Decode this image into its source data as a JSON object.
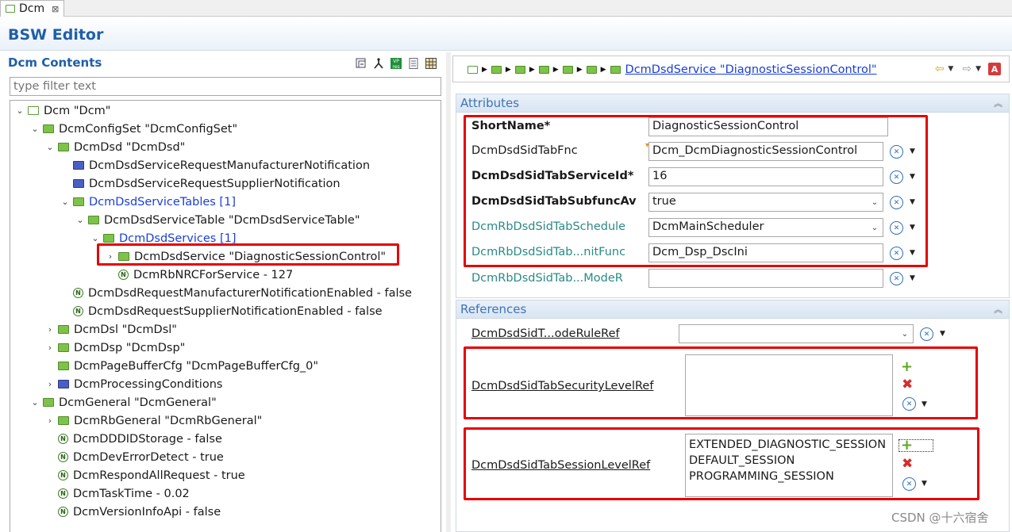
{
  "tab": {
    "label": "Dcm",
    "close": "⊠"
  },
  "header": {
    "title": "BSW Editor"
  },
  "left": {
    "title": "Dcm Contents",
    "filter_placeholder": "type filter text",
    "tree": [
      {
        "label": "Dcm \"Dcm\"",
        "indent": 0,
        "twisty": "⌄",
        "icon": "white"
      },
      {
        "label": "DcmConfigSet \"DcmConfigSet\"",
        "indent": 1,
        "twisty": "⌄",
        "icon": "green"
      },
      {
        "label": "DcmDsd \"DcmDsd\"",
        "indent": 2,
        "twisty": "⌄",
        "icon": "green"
      },
      {
        "label": "DcmDsdServiceRequestManufacturerNotification",
        "indent": 3,
        "twisty": "",
        "icon": "blue"
      },
      {
        "label": "DcmDsdServiceRequestSupplierNotification",
        "indent": 3,
        "twisty": "",
        "icon": "blue"
      },
      {
        "label": "DcmDsdServiceTables [1]",
        "indent": 3,
        "twisty": "⌄",
        "icon": "green",
        "link": true
      },
      {
        "label": "DcmDsdServiceTable \"DcmDsdServiceTable\"",
        "indent": 4,
        "twisty": "⌄",
        "icon": "green"
      },
      {
        "label": "DcmDsdServices [1]",
        "indent": 5,
        "twisty": "⌄",
        "icon": "green",
        "link": true
      },
      {
        "label": "DcmDsdService \"DiagnosticSessionControl\"",
        "indent": 6,
        "twisty": "›",
        "icon": "green"
      },
      {
        "label": "DcmRbNRCForService - 127",
        "indent": 6,
        "twisty": "",
        "icon": "n"
      },
      {
        "label": "DcmDsdRequestManufacturerNotificationEnabled - false",
        "indent": 3,
        "twisty": "",
        "icon": "n"
      },
      {
        "label": "DcmDsdRequestSupplierNotificationEnabled - false",
        "indent": 3,
        "twisty": "",
        "icon": "n"
      },
      {
        "label": "DcmDsl \"DcmDsl\"",
        "indent": 2,
        "twisty": "›",
        "icon": "green"
      },
      {
        "label": "DcmDsp \"DcmDsp\"",
        "indent": 2,
        "twisty": "›",
        "icon": "green"
      },
      {
        "label": "DcmPageBufferCfg \"DcmPageBufferCfg_0\"",
        "indent": 2,
        "twisty": "",
        "icon": "green"
      },
      {
        "label": "DcmProcessingConditions",
        "indent": 2,
        "twisty": "›",
        "icon": "blue"
      },
      {
        "label": "DcmGeneral \"DcmGeneral\"",
        "indent": 1,
        "twisty": "⌄",
        "icon": "green"
      },
      {
        "label": "DcmRbGeneral \"DcmRbGeneral\"",
        "indent": 2,
        "twisty": "›",
        "icon": "green"
      },
      {
        "label": "DcmDDDIDStorage - false",
        "indent": 2,
        "twisty": "",
        "icon": "n"
      },
      {
        "label": "DcmDevErrorDetect - true",
        "indent": 2,
        "twisty": "",
        "icon": "n"
      },
      {
        "label": "DcmRespondAllRequest - true",
        "indent": 2,
        "twisty": "",
        "icon": "n"
      },
      {
        "label": "DcmTaskTime - 0.02",
        "indent": 2,
        "twisty": "",
        "icon": "n"
      },
      {
        "label": "DcmVersionInfoApi - false",
        "indent": 2,
        "twisty": "",
        "icon": "n"
      }
    ]
  },
  "breadcrumb": {
    "current": "DcmDsdService \"DiagnosticSessionControl\""
  },
  "attributes": {
    "title": "Attributes",
    "fields": [
      {
        "label": "ShortName*",
        "value": "DiagnosticSessionControl"
      },
      {
        "label": "DcmDsdSidTabFnc",
        "value": "Dcm_DcmDiagnosticSessionControl"
      },
      {
        "label": "DcmDsdSidTabServiceId*",
        "value": "16"
      },
      {
        "label": "DcmDsdSidTabSubfuncAv",
        "value": "true"
      },
      {
        "label": "DcmRbDsdSidTabSchedule",
        "value": "DcmMainScheduler"
      },
      {
        "label": "DcmRbDsdSidTab...nitFunc",
        "value": "Dcm_Dsp_DscIni"
      },
      {
        "label": "DcmRbDsdSidTab...ModeR",
        "value": ""
      }
    ]
  },
  "references": {
    "title": "References",
    "mode_rule_label": "DcmDsdSidT...odeRuleRef",
    "security_label": "DcmDsdSidTabSecurityLevelRef",
    "session_label": "DcmDsdSidTabSessionLevelRef",
    "session_values": [
      "EXTENDED_DIAGNOSTIC_SESSION",
      "DEFAULT_SESSION",
      "PROGRAMMING_SESSION"
    ]
  },
  "watermark": "CSDN @十六宿舍",
  "colors": {
    "accent": "#1f5fa8",
    "highlight": "#e60000",
    "folder": "#7ec24a"
  }
}
